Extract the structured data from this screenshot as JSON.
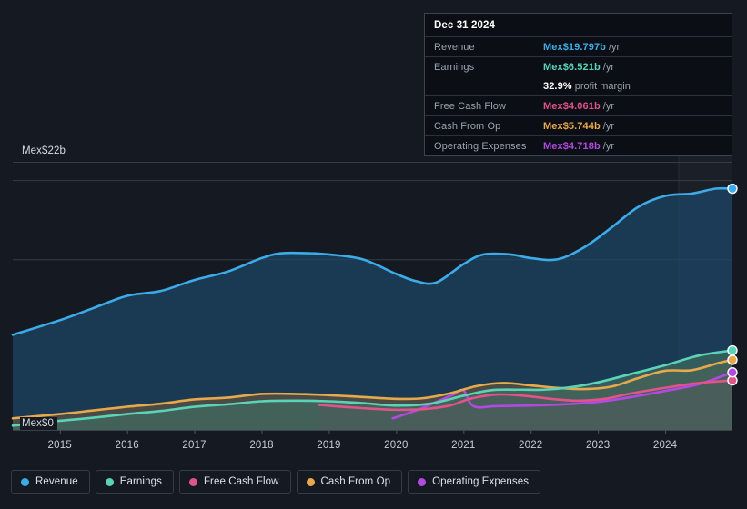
{
  "chart_data": {
    "type": "area",
    "title": "",
    "xlabel": "",
    "ylabel": "",
    "currency_prefix": "Mex$",
    "ylim": [
      0,
      22
    ],
    "y_axis_labels": {
      "top": "Mex$22b",
      "zero": "Mex$0"
    },
    "grid": true,
    "gridlines_value": [
      22,
      20.5,
      14,
      0
    ],
    "x_ticks": [
      "2015",
      "2016",
      "2017",
      "2018",
      "2019",
      "2020",
      "2021",
      "2022",
      "2023",
      "2024"
    ],
    "x_range": [
      "2014.3",
      "2025.0"
    ],
    "legend_position": "bottom",
    "highlight_band": {
      "from": "2024.2",
      "to": "2025.0",
      "label": "recent-period"
    },
    "series": [
      {
        "name": "Revenue",
        "color": "#3cabe8",
        "fill": "#1d4668",
        "x": [
          2014.3,
          2015,
          2015.5,
          2016,
          2016.5,
          2017,
          2017.5,
          2018,
          2018.3,
          2018.7,
          2019,
          2019.5,
          2020,
          2020.3,
          2020.6,
          2021,
          2021.3,
          2021.7,
          2022,
          2022.4,
          2022.8,
          2023.2,
          2023.6,
          2024,
          2024.4,
          2024.75,
          2025
        ],
        "values": [
          7.8,
          9.0,
          10.0,
          11.0,
          11.4,
          12.3,
          13.0,
          14.1,
          14.5,
          14.5,
          14.4,
          14.0,
          12.8,
          12.2,
          12.1,
          13.6,
          14.4,
          14.4,
          14.1,
          14.0,
          15.0,
          16.6,
          18.3,
          19.2,
          19.4,
          19.8,
          19.797
        ]
      },
      {
        "name": "Earnings",
        "color": "#5ad3b8",
        "fill": "#3f6a60",
        "x": [
          2014.3,
          2015,
          2015.5,
          2016,
          2016.5,
          2017,
          2017.5,
          2018,
          2018.5,
          2019,
          2019.5,
          2020,
          2020.5,
          2021,
          2021.4,
          2021.8,
          2022.2,
          2022.6,
          2023,
          2023.5,
          2024,
          2024.5,
          2025
        ],
        "values": [
          0.35,
          0.75,
          1.0,
          1.3,
          1.55,
          1.9,
          2.1,
          2.35,
          2.4,
          2.35,
          2.2,
          2.0,
          2.15,
          2.8,
          3.25,
          3.3,
          3.3,
          3.5,
          3.9,
          4.6,
          5.3,
          6.1,
          6.521
        ]
      },
      {
        "name": "Free Cash Flow",
        "color": "#e0548a",
        "fill": "#6b4050",
        "x": [
          2018.85,
          2019.2,
          2019.6,
          2020,
          2020.4,
          2020.8,
          2021.1,
          2021.5,
          2021.9,
          2022.3,
          2022.7,
          2023.1,
          2023.5,
          2024,
          2024.5,
          2025
        ],
        "values": [
          2.05,
          1.9,
          1.75,
          1.65,
          1.7,
          2.0,
          2.55,
          2.9,
          2.8,
          2.55,
          2.4,
          2.55,
          3.0,
          3.45,
          3.85,
          4.061
        ]
      },
      {
        "name": "Cash From Op",
        "color": "#e8a84c",
        "fill": "#5e5240",
        "x": [
          2014.3,
          2015,
          2015.5,
          2016,
          2016.5,
          2017,
          2017.5,
          2018,
          2018.5,
          2019,
          2019.5,
          2020,
          2020.4,
          2020.8,
          2021.2,
          2021.6,
          2022,
          2022.4,
          2022.8,
          2023.2,
          2023.6,
          2024,
          2024.4,
          2024.8,
          2025
        ],
        "values": [
          0.95,
          1.3,
          1.6,
          1.9,
          2.15,
          2.5,
          2.65,
          2.95,
          2.95,
          2.85,
          2.7,
          2.55,
          2.6,
          3.0,
          3.6,
          3.85,
          3.65,
          3.45,
          3.35,
          3.55,
          4.25,
          4.85,
          4.9,
          5.5,
          5.744
        ]
      },
      {
        "name": "Operating Expenses",
        "color": "#b04ae0",
        "fill": "#6a4a74",
        "x": [
          2019.95,
          2020.3,
          2020.6,
          2020.85,
          2021.0,
          2021.15,
          2021.5,
          2022,
          2022.5,
          2023,
          2023.5,
          2024,
          2024.5,
          2025
        ],
        "values": [
          0.95,
          1.6,
          2.3,
          2.9,
          3.25,
          1.95,
          1.95,
          2.0,
          2.1,
          2.3,
          2.7,
          3.2,
          3.75,
          4.718
        ]
      }
    ]
  },
  "tooltip": {
    "date": "Dec 31 2024",
    "rows": [
      {
        "key": "Revenue",
        "value": "Mex$19.797b",
        "suffix": "/yr",
        "color": "#3cabe8"
      },
      {
        "key": "Earnings",
        "value": "Mex$6.521b",
        "suffix": "/yr",
        "color": "#5ad3b8"
      },
      {
        "key": "",
        "value": "32.9%",
        "suffix": "profit margin",
        "color": "#ffffff"
      },
      {
        "key": "Free Cash Flow",
        "value": "Mex$4.061b",
        "suffix": "/yr",
        "color": "#e0548a"
      },
      {
        "key": "Cash From Op",
        "value": "Mex$5.744b",
        "suffix": "/yr",
        "color": "#e8a84c"
      },
      {
        "key": "Operating Expenses",
        "value": "Mex$4.718b",
        "suffix": "/yr",
        "color": "#b04ae0"
      }
    ]
  },
  "legend": {
    "items": [
      {
        "label": "Revenue",
        "color": "#3cabe8"
      },
      {
        "label": "Earnings",
        "color": "#5ad3b8"
      },
      {
        "label": "Free Cash Flow",
        "color": "#e0548a"
      },
      {
        "label": "Cash From Op",
        "color": "#e8a84c"
      },
      {
        "label": "Operating Expenses",
        "color": "#b04ae0"
      }
    ]
  }
}
